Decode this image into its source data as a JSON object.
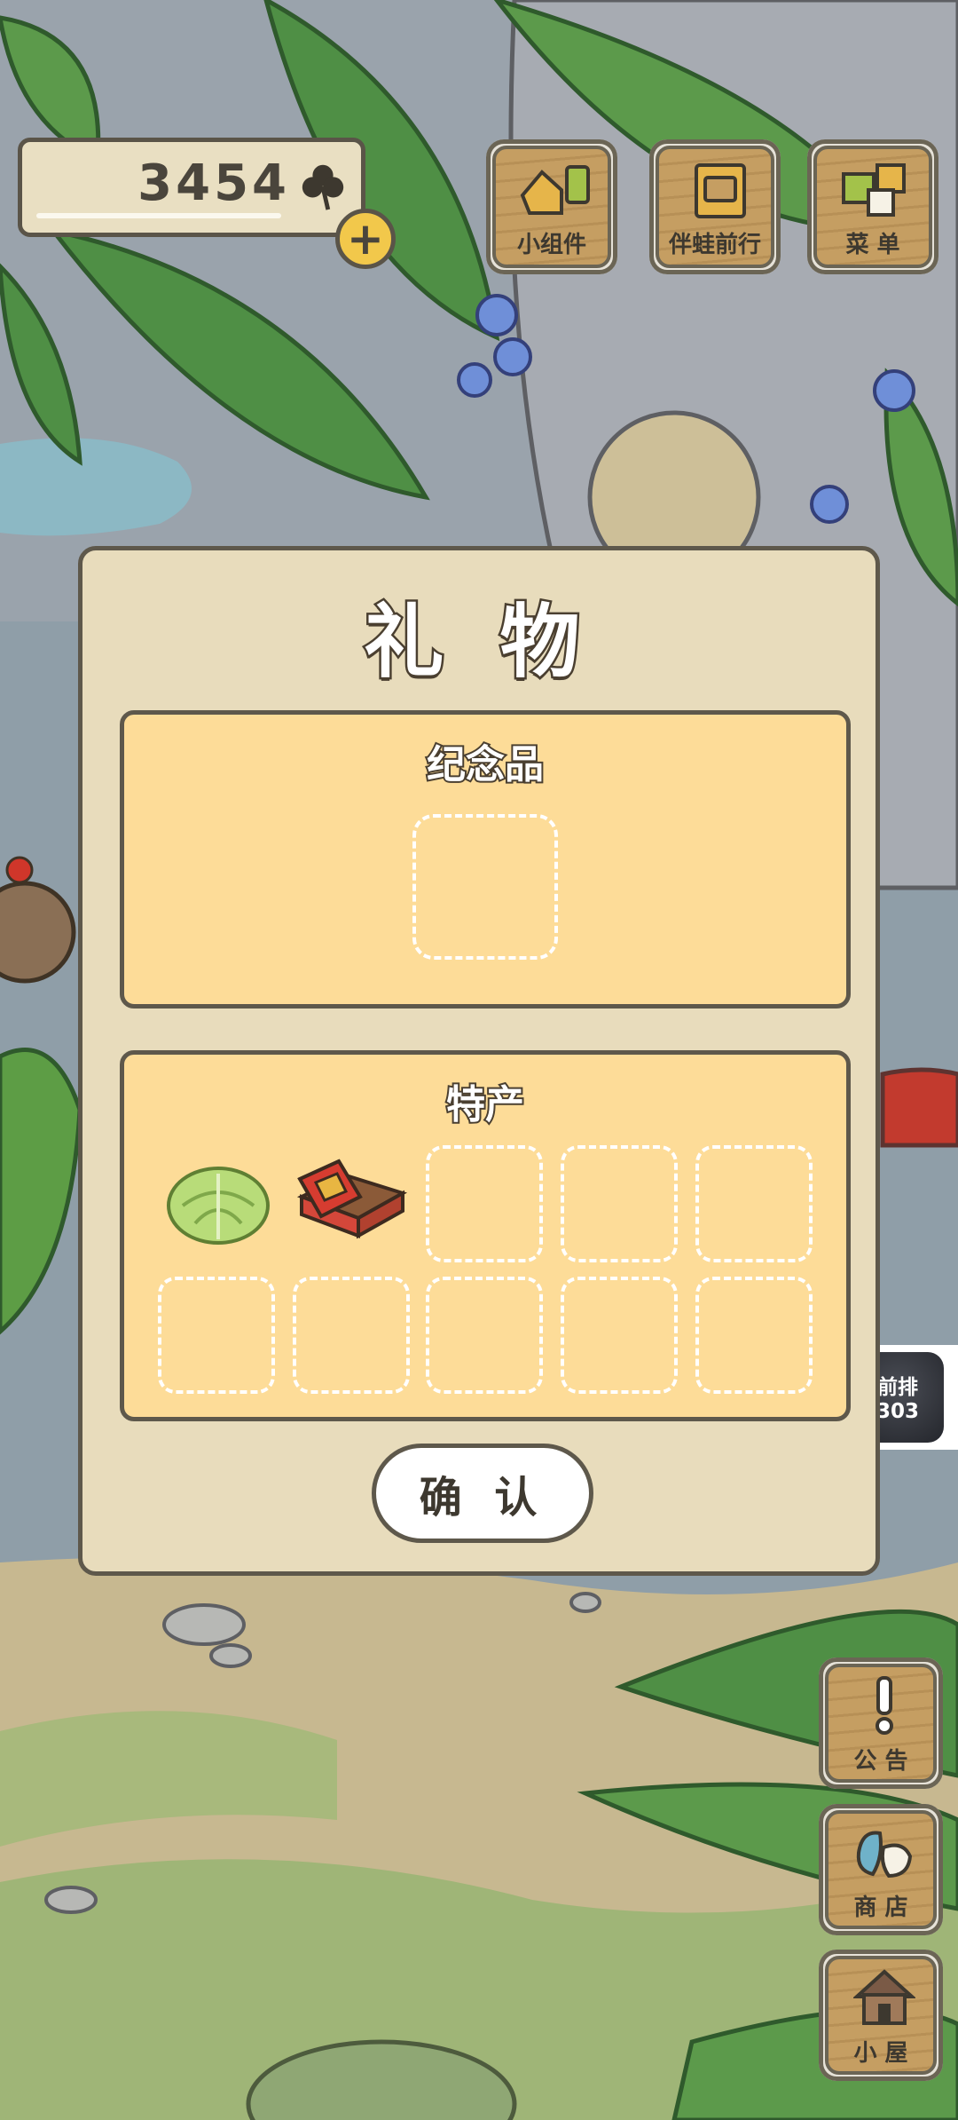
{
  "currency": {
    "amount": "3454",
    "icon": "clover-icon",
    "add_icon": "plus-icon"
  },
  "top_menu": [
    {
      "label": "小组件",
      "icon": "widget-icon"
    },
    {
      "label": "伴蛙前行",
      "icon": "journal-icon"
    },
    {
      "label": "菜 单",
      "icon": "menu-icon"
    }
  ],
  "side_menu": [
    {
      "label": "公 告",
      "icon": "exclamation-icon"
    },
    {
      "label": "商 店",
      "icon": "shop-bag-icon"
    },
    {
      "label": "小 屋",
      "icon": "house-icon"
    }
  ],
  "rank_chip": {
    "line1": "前排",
    "line2": "303"
  },
  "gift_dialog": {
    "title": "礼 物",
    "souvenir": {
      "title": "纪念品",
      "slots": 1
    },
    "specialty": {
      "title": "特产",
      "items": [
        "cabbage-icon",
        "snack-box-icon"
      ],
      "slots": 10
    },
    "confirm_label": "确 认"
  },
  "colors": {
    "panel_bg": "#fddc98",
    "dialog_bg": "#e8dcbc",
    "outline": "#5e584b",
    "wood": "#c59e62",
    "coin_yellow": "#f2c84b"
  }
}
